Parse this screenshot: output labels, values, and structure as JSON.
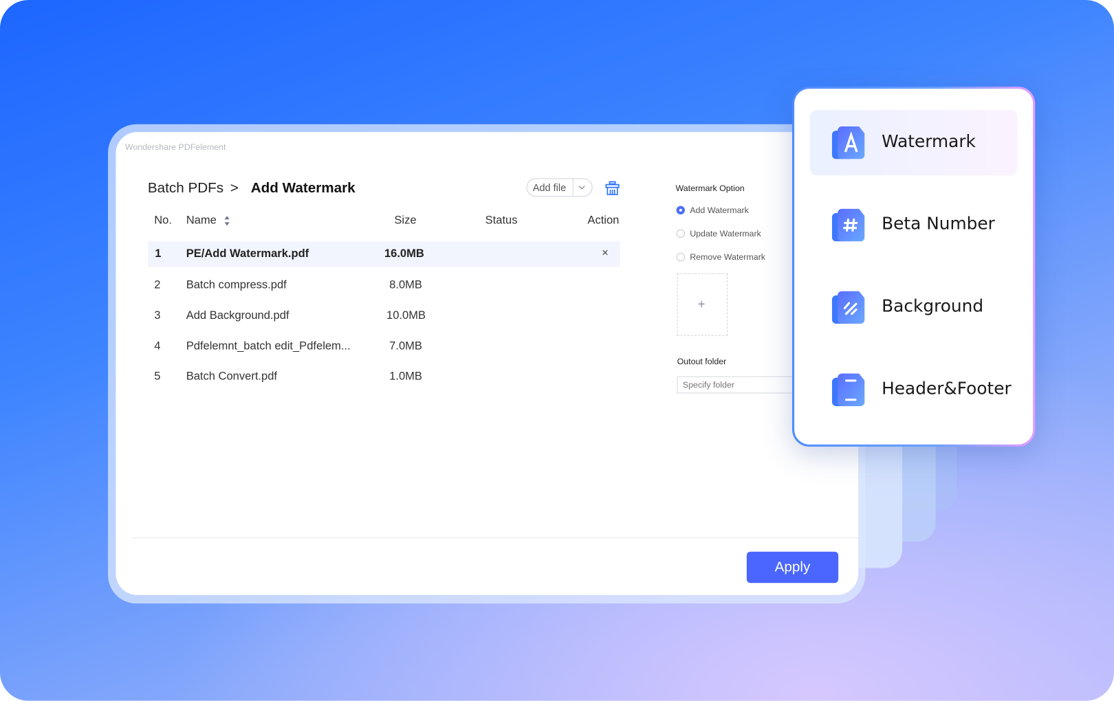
{
  "app_title": "Wondershare PDFelement",
  "breadcrumb": {
    "parent": "Batch PDFs",
    "separator": ">",
    "current": "Add Watermark"
  },
  "toolbar": {
    "add_file": "Add file",
    "dropdown_icon": "chevron-down-icon",
    "clear_icon": "trash-icon"
  },
  "table": {
    "headers": {
      "no": "No.",
      "name": "Name",
      "size": "Size",
      "status": "Status",
      "action": "Action"
    },
    "rows": [
      {
        "no": "1",
        "name": "PE/Add Watermark.pdf",
        "size": "16.0MB",
        "status": "",
        "action": "×",
        "selected": true
      },
      {
        "no": "2",
        "name": "Batch compress.pdf",
        "size": "8.0MB",
        "status": ""
      },
      {
        "no": "3",
        "name": "Add Background.pdf",
        "size": "10.0MB",
        "status": ""
      },
      {
        "no": "4",
        "name": "Pdfelemnt_batch edit_Pdfelem...",
        "size": "7.0MB",
        "status": ""
      },
      {
        "no": "5",
        "name": "Batch Convert.pdf",
        "size": "1.0MB",
        "status": ""
      }
    ]
  },
  "options": {
    "title": "Watermark Option",
    "radios": [
      {
        "label": "Add Watermark",
        "checked": true
      },
      {
        "label": "Update Watermark",
        "checked": false
      },
      {
        "label": "Remove Watermark",
        "checked": false
      }
    ],
    "add_symbol": "+",
    "output_label": "Outout folder",
    "output_placeholder": "Specify folder"
  },
  "apply_label": "Apply",
  "menu": {
    "items": [
      {
        "label": "Watermark",
        "icon": "letter-a-icon",
        "selected": true
      },
      {
        "label": "Beta Number",
        "icon": "hash-icon"
      },
      {
        "label": "Background",
        "icon": "diagonal-lines-icon"
      },
      {
        "label": "Header&Footer",
        "icon": "header-footer-icon"
      }
    ]
  },
  "colors": {
    "accent": "#4a66ff",
    "background_top": "#1d66ff",
    "selected_row": "#f2f5fd"
  }
}
